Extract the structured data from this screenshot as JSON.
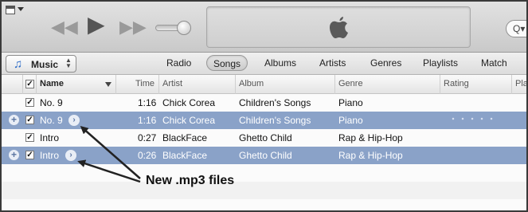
{
  "navbar": {
    "source_label": "Music",
    "tabs": [
      "Radio",
      "Songs",
      "Albums",
      "Artists",
      "Genres",
      "Playlists",
      "Match"
    ],
    "active_tab": "Songs"
  },
  "columns": {
    "name": "Name",
    "time": "Time",
    "artist": "Artist",
    "album": "Album",
    "genre": "Genre",
    "rating": "Rating",
    "plays": "Pla"
  },
  "rows": [
    {
      "name": "No. 9",
      "time": "1:16",
      "artist": "Chick Corea",
      "album": "Children's Songs",
      "genre": "Piano",
      "checked": "✓"
    },
    {
      "name": "No. 9",
      "time": "1:16",
      "artist": "Chick Corea",
      "album": "Children's Songs",
      "genre": "Piano",
      "checked": "✓"
    },
    {
      "name": "Intro",
      "time": "0:27",
      "artist": "BlackFace",
      "album": "Ghetto Child",
      "genre": "Rap & Hip-Hop",
      "checked": "✓"
    },
    {
      "name": "Intro",
      "time": "0:26",
      "artist": "BlackFace",
      "album": "Ghetto Child",
      "genre": "Rap & Hip-Hop",
      "checked": "✓"
    }
  ],
  "header_checkbox": "✓",
  "annotation": {
    "text": "New .mp3 files"
  },
  "icons": {
    "prev": "rewind-icon",
    "play": "play-icon",
    "next": "fast-forward-icon",
    "apple": "apple-logo-icon",
    "search": "search-icon",
    "note": "music-note-icon"
  },
  "colors": {
    "selected_row": "#8aa2c8",
    "accent": "#2a6ac7"
  }
}
